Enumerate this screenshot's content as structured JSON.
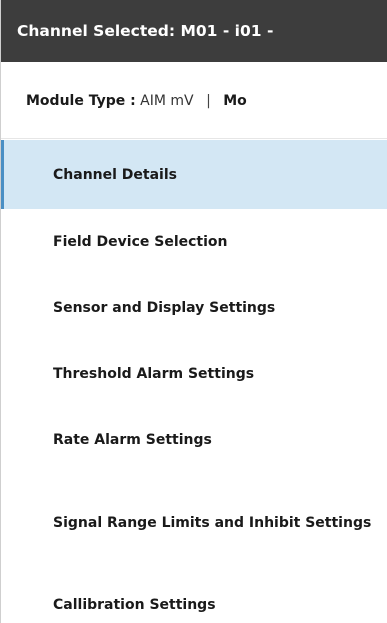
{
  "header": {
    "title": "Channel Selected: M01 - i01 -"
  },
  "module_info": {
    "type_label": "Module Type :",
    "type_value": "AIM mV",
    "separator": "|",
    "next_label": "Mo"
  },
  "nav": {
    "items": [
      {
        "label": "Channel Details",
        "selected": true
      },
      {
        "label": "Field Device Selection"
      },
      {
        "label": "Sensor and Display Settings"
      },
      {
        "label": "Threshold Alarm Settings"
      },
      {
        "label": "Rate Alarm Settings"
      },
      {
        "label": "Signal Range Limits and Inhibit Settings"
      },
      {
        "label": "Callibration Settings"
      }
    ]
  },
  "colors": {
    "title_bar_bg": "#3d3d3d",
    "selected_bg": "#d3e7f4",
    "selected_accent": "#4a8fc4"
  }
}
